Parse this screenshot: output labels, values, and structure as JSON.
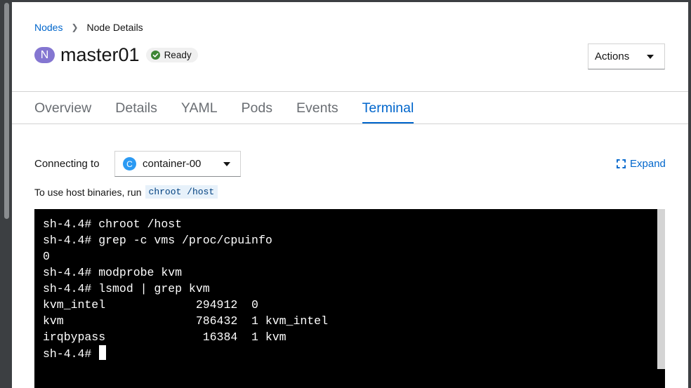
{
  "breadcrumb": {
    "parent": "Nodes",
    "current": "Node Details"
  },
  "node": {
    "badge": "N",
    "name": "master01",
    "status": "Ready"
  },
  "actions": {
    "label": "Actions"
  },
  "tabs": [
    {
      "label": "Overview",
      "active": false
    },
    {
      "label": "Details",
      "active": false
    },
    {
      "label": "YAML",
      "active": false
    },
    {
      "label": "Pods",
      "active": false
    },
    {
      "label": "Events",
      "active": false
    },
    {
      "label": "Terminal",
      "active": true
    }
  ],
  "connection": {
    "label": "Connecting to",
    "container_badge": "C",
    "container": "container-00",
    "expand_label": "Expand"
  },
  "hint": {
    "text": "To use host binaries, run",
    "command": "chroot /host"
  },
  "terminal": {
    "lines": [
      "sh-4.4# chroot /host",
      "sh-4.4# grep -c vms /proc/cpuinfo",
      "0",
      "sh-4.4# modprobe kvm",
      "sh-4.4# lsmod | grep kvm",
      "kvm_intel             294912  0",
      "kvm                   786432  1 kvm_intel",
      "irqbypass              16384  1 kvm",
      "sh-4.4# "
    ]
  },
  "colors": {
    "accent": "#0066cc",
    "ready": "#3e8635",
    "node_badge": "#8476d1",
    "container_badge": "#2b9af3"
  }
}
